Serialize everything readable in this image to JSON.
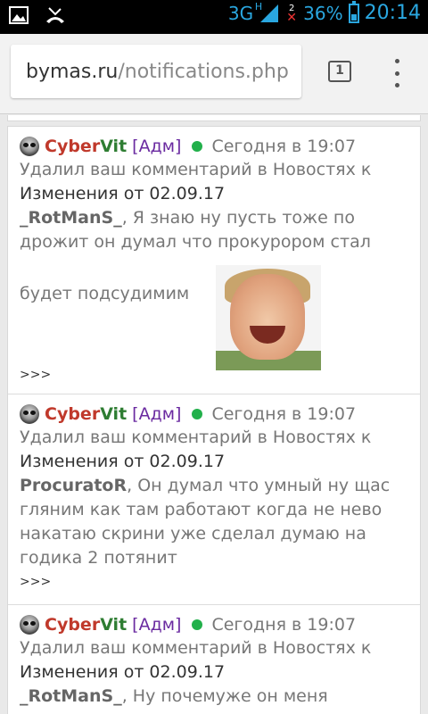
{
  "status_bar": {
    "network": "3G",
    "network_sub": "H",
    "alert_count": "2",
    "battery": "36%",
    "time": "20:14"
  },
  "browser": {
    "url_host": "bymas.ru",
    "url_path": "/notifications.php",
    "tab_count": "1"
  },
  "notifications": [
    {
      "user_part1": "Cyber",
      "user_part2": "Vit",
      "role": "[Адм]",
      "date": "Сегодня в 19:07",
      "action": "Удалил ваш комментарий в Новостях к",
      "title": "Изменения от 02.09.17",
      "commenter": "_RotManS_",
      "body_line1": ", Я знаю ну пусть тоже по",
      "body_line2": "дрожит он думал что прокурором стал",
      "body_line3": "будет подсудимим",
      "more": ">>>"
    },
    {
      "user_part1": "Cyber",
      "user_part2": "Vit",
      "role": "[Адм]",
      "date": "Сегодня в 19:07",
      "action": "Удалил ваш комментарий в Новостях к",
      "title": "Изменения от 02.09.17",
      "commenter": "ProcuratoR",
      "body_line1": ", Он думал что умный ну щас",
      "body_line2": "гляним как там работают когда не нево",
      "body_line3": "накатаю скрини уже сделал думаю на",
      "body_line4": "годика 2 потянит",
      "more": ">>>"
    },
    {
      "user_part1": "Cyber",
      "user_part2": "Vit",
      "role": "[Адм]",
      "date": "Сегодня в 19:07",
      "action": "Удалил ваш комментарий в Новостях к",
      "title": "Изменения от 02.09.17",
      "commenter": "_RotManS_",
      "body_line1": ", Ну почемуже он меня"
    }
  ]
}
